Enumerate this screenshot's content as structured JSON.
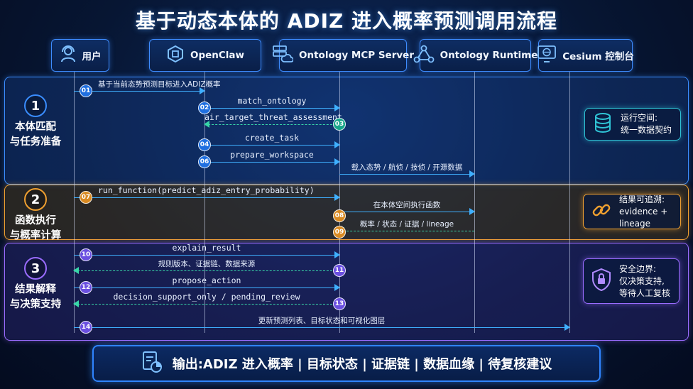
{
  "title": "基于动态本体的 ADIZ 进入概率预测调用流程",
  "actors": [
    {
      "key": "user",
      "name": "用户",
      "icon": "user-headset-icon"
    },
    {
      "key": "openclaw",
      "name": "OpenClaw",
      "icon": "hexagon-chip-icon"
    },
    {
      "key": "mcp",
      "name": "Ontology MCP Server",
      "icon": "server-cloud-icon"
    },
    {
      "key": "runtime",
      "name": "Ontology Runtime",
      "icon": "node-graph-icon"
    },
    {
      "key": "cesium",
      "name": "Cesium 控制台",
      "icon": "globe-monitor-icon"
    }
  ],
  "phases": [
    {
      "number": "1",
      "label": "本体匹配\n与任务准备",
      "color": "#3a8dff"
    },
    {
      "number": "2",
      "label": "函数执行\n与概率计算",
      "color": "#f0a030"
    },
    {
      "number": "3",
      "label": "结果解释\n与决策支持",
      "color": "#9a6cff"
    }
  ],
  "messages": [
    {
      "step": "01",
      "text": "基于当前态势预测目标进入ADIZ概率",
      "from": "user",
      "to": "openclaw",
      "style": "solid",
      "lang": "zh"
    },
    {
      "step": "02",
      "text": "match_ontology",
      "from": "openclaw",
      "to": "mcp",
      "style": "solid",
      "lang": "code"
    },
    {
      "step": "03",
      "text": "air_target_threat_assessment",
      "from": "mcp",
      "to": "openclaw",
      "style": "dashed",
      "lang": "code"
    },
    {
      "step": "04",
      "text": "create_task",
      "from": "openclaw",
      "to": "mcp",
      "style": "solid",
      "lang": "code"
    },
    {
      "step": "06",
      "text": "prepare_workspace",
      "from": "openclaw",
      "to": "mcp",
      "style": "solid",
      "lang": "code"
    },
    {
      "step": "",
      "text": "载入态势 / 航侦 / 技侦 / 开源数据",
      "from": "mcp",
      "to": "runtime",
      "style": "solid",
      "lang": "zh"
    },
    {
      "step": "07",
      "text": "run_function(predict_adiz_entry_probability)",
      "from": "user",
      "to": "mcp",
      "style": "solid",
      "lang": "code"
    },
    {
      "step": "08",
      "text": "在本体空间执行函数",
      "from": "mcp",
      "to": "runtime",
      "style": "solid",
      "lang": "zh"
    },
    {
      "step": "09",
      "text": "概率 / 状态 / 证据 / lineage",
      "from": "runtime",
      "to": "mcp",
      "style": "dashed",
      "lang": "zh"
    },
    {
      "step": "10",
      "text": "explain_result",
      "from": "user",
      "to": "mcp",
      "style": "solid",
      "lang": "code"
    },
    {
      "step": "11",
      "text": "规则版本、证据链、数据来源",
      "from": "mcp",
      "to": "user",
      "style": "dashed",
      "lang": "zh"
    },
    {
      "step": "12",
      "text": "propose_action",
      "from": "user",
      "to": "mcp",
      "style": "solid",
      "lang": "code"
    },
    {
      "step": "13",
      "text": "decision_support_only / pending_review",
      "from": "mcp",
      "to": "user",
      "style": "dashed",
      "lang": "code"
    },
    {
      "step": "14",
      "text": "更新预测列表、目标状态和可视化图层",
      "from": "user",
      "to": "cesium",
      "style": "solid",
      "lang": "zh"
    }
  ],
  "notes": [
    {
      "text": "运行空间:\n统一数据契约",
      "icon": "database-icon",
      "color": "#2fc4d6"
    },
    {
      "text": "结果可追溯:\nevidence + lineage",
      "icon": "chain-link-icon",
      "color": "#f0a030"
    },
    {
      "text": "安全边界:\n仅决策支持,\n等待人工复核",
      "icon": "lock-shield-icon",
      "color": "#9a6cff"
    }
  ],
  "footer": {
    "text": "输出:ADIZ 进入概率 | 目标状态 | 证据链 | 数据血缘 | 待复核建议",
    "icon": "report-chart-icon"
  },
  "colors": {
    "accent": "#3e8cff",
    "solid_arrow": "#3fb0ff",
    "dashed_arrow": "#38d6a8",
    "step_blue": "#1f6fe0",
    "step_teal": "#17a58a",
    "step_orange": "#d98a22",
    "step_violet": "#6a4fe0"
  }
}
